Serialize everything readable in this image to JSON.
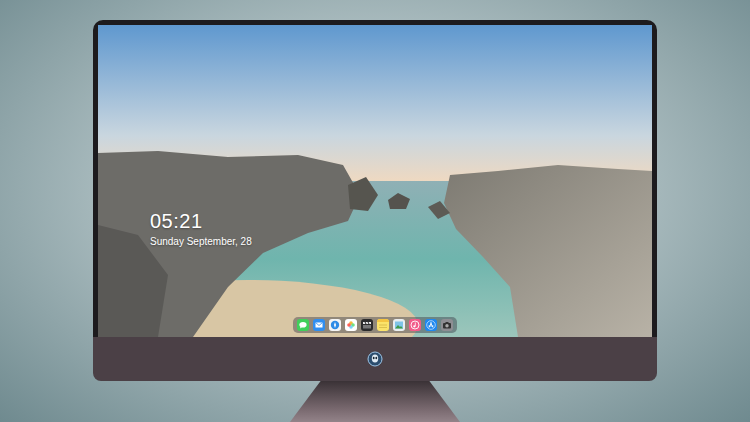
{
  "lock_screen": {
    "time": "05:21",
    "date": "Sunday September, 28"
  },
  "dock": {
    "apps": [
      {
        "kind": "messages"
      },
      {
        "kind": "mail"
      },
      {
        "kind": "safari"
      },
      {
        "kind": "photos"
      },
      {
        "kind": "video"
      },
      {
        "kind": "notes"
      },
      {
        "kind": "gallery"
      },
      {
        "kind": "music"
      },
      {
        "kind": "appstore"
      },
      {
        "kind": "camera"
      }
    ]
  }
}
